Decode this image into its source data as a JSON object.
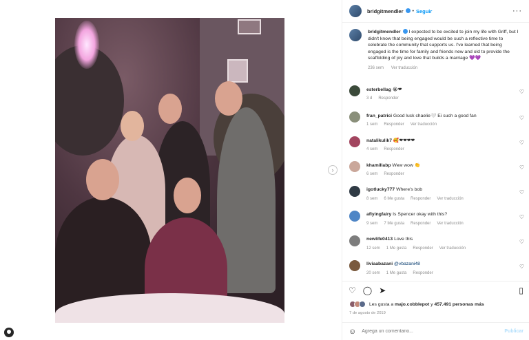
{
  "post": {
    "username": "bridgitmendler",
    "follow_label": "Seguir",
    "more_label": "···",
    "caption": "I expected to be excited to join my life with Griff, but I didn't know that being engaged would be such a reflective time to celebrate the community that supports us. I've learned that being engaged is the time for family and friends new and old to provide the scaffolding of joy and love that builds a marriage",
    "caption_emoji": "💜💜",
    "caption_age": "236 sem",
    "caption_translate": "Ver traducción"
  },
  "comments": [
    {
      "user": "esterbellag",
      "text": "😭❤",
      "age": "3 d",
      "likes": "",
      "reply": "Responder",
      "translate": ""
    },
    {
      "user": "fran_patrici",
      "text": "Good luck chaelie🤍 Ei such a good fan",
      "age": "1 sem",
      "likes": "",
      "reply": "Responder",
      "translate": "Ver traducción"
    },
    {
      "user": "natalikulik7",
      "text": "🥰❤❤❤❤",
      "age": "4 sem",
      "likes": "",
      "reply": "Responder",
      "translate": ""
    },
    {
      "user": "khamillabp",
      "text": "Wew wow 👏",
      "age": "6 sem",
      "likes": "",
      "reply": "Responder",
      "translate": ""
    },
    {
      "user": "igotlucky777",
      "text": "Where's bob",
      "age": "8 sem",
      "likes": "6 Me gusta",
      "reply": "Responder",
      "translate": "Ver traducción"
    },
    {
      "user": "aflyingfairy",
      "text": "Is Spencer okay with this?",
      "age": "9 sem",
      "likes": "7 Me gusta",
      "reply": "Responder",
      "translate": "Ver traducción"
    },
    {
      "user": "newlife0413",
      "text": "Love this",
      "age": "12 sem",
      "likes": "1 Me gusta",
      "reply": "Responder",
      "translate": "Ver traducción"
    },
    {
      "user": "liviaabazani",
      "text": "@vbazani48",
      "age": "20 sem",
      "likes": "1 Me gusta",
      "reply": "Responder",
      "translate": ""
    }
  ],
  "likes": {
    "prefix": "Les gusta a",
    "first_user": "majo.cobblepot",
    "connector": "y",
    "others": "457.491 personas más"
  },
  "date": "7 de agosto de 2019",
  "add_comment": {
    "placeholder": "Agrega un comentario...",
    "publish_label": "Publicar"
  },
  "icons": {
    "heart": "heart-icon",
    "comment": "comment-icon",
    "share": "share-icon",
    "save": "bookmark-icon",
    "emoji": "emoji-icon"
  },
  "colors": {
    "accent": "#0095f6",
    "verified": "#3897f0",
    "muted": "#8e8e8e"
  }
}
